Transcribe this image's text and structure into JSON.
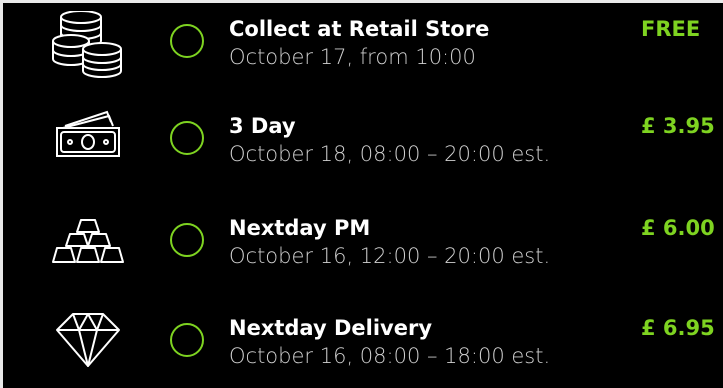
{
  "colors": {
    "background": "#000000",
    "accent": "#7ed321",
    "title": "#ffffff",
    "subtitle": "#cfcfcf"
  },
  "options": [
    {
      "icon": "coins-icon",
      "title": "Collect at Retail Store",
      "subtitle": "October 17, from 10:00",
      "price": "FREE"
    },
    {
      "icon": "banknotes-icon",
      "title": "3 Day",
      "subtitle": "October 18, 08:00 – 20:00 est.",
      "price": "£ 3.95"
    },
    {
      "icon": "gold-bars-icon",
      "title": "Nextday PM",
      "subtitle": "October 16, 12:00 – 20:00 est.",
      "price": "£ 6.00"
    },
    {
      "icon": "diamond-icon",
      "title": "Nextday Delivery",
      "subtitle": "October 16, 08:00 – 18:00 est.",
      "price": "£ 6.95"
    }
  ]
}
